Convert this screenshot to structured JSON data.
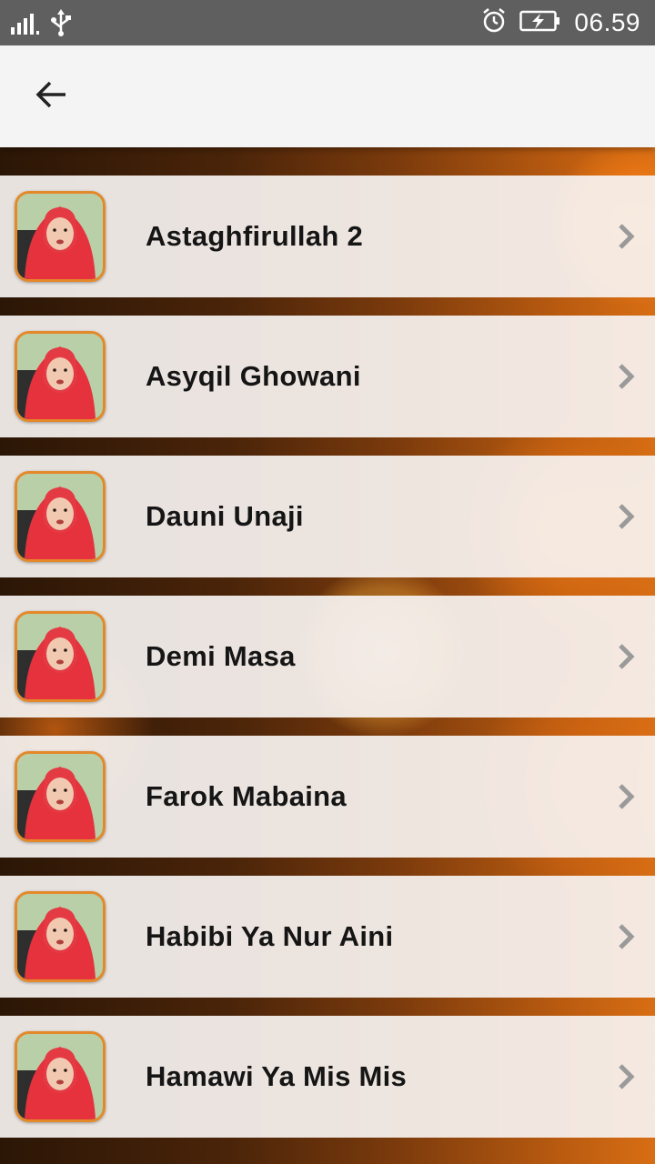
{
  "status_bar": {
    "time": "06.59",
    "icons": [
      "signal-icon",
      "usb-icon",
      "alarm-icon",
      "battery-charging-icon"
    ]
  },
  "app_bar": {
    "back_icon": "arrow-left-icon"
  },
  "colors": {
    "status_bar_bg": "#5f5f5f",
    "app_bar_bg": "#f4f4f4",
    "thumb_border": "#e4892a",
    "title_text": "#151515",
    "chevron": "#9a9a9a"
  },
  "songs": [
    {
      "title": "Astaghfirullah 2"
    },
    {
      "title": "Asyqil Ghowani"
    },
    {
      "title": "Dauni Unaji"
    },
    {
      "title": "Demi Masa"
    },
    {
      "title": "Farok Mabaina"
    },
    {
      "title": "Habibi Ya Nur Aini"
    },
    {
      "title": "Hamawi Ya Mis Mis"
    }
  ]
}
